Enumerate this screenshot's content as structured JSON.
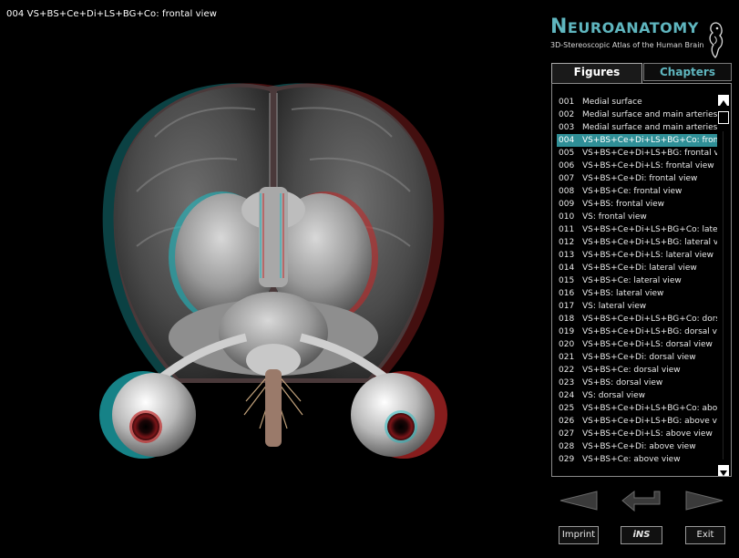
{
  "viewer": {
    "caption": "004  VS+BS+Ce+Di+LS+BG+Co: frontal view"
  },
  "logo": {
    "title_first": "N",
    "title_rest": "EUROANATOMY",
    "subtitle": "3D-Stereoscopic Atlas of the Human Brain"
  },
  "tabs": {
    "figures": "Figures",
    "chapters": "Chapters",
    "active": "Figures"
  },
  "figures": [
    {
      "num": "001",
      "label": "Medial surface"
    },
    {
      "num": "002",
      "label": "Medial surface and main arteries"
    },
    {
      "num": "003",
      "label": "Medial surface and main arteries"
    },
    {
      "num": "004",
      "label": "VS+BS+Ce+Di+LS+BG+Co: frontal view"
    },
    {
      "num": "005",
      "label": "VS+BS+Ce+Di+LS+BG: frontal view"
    },
    {
      "num": "006",
      "label": "VS+BS+Ce+Di+LS: frontal view"
    },
    {
      "num": "007",
      "label": "VS+BS+Ce+Di: frontal view"
    },
    {
      "num": "008",
      "label": "VS+BS+Ce: frontal view"
    },
    {
      "num": "009",
      "label": "VS+BS: frontal view"
    },
    {
      "num": "010",
      "label": "VS: frontal view"
    },
    {
      "num": "011",
      "label": "VS+BS+Ce+Di+LS+BG+Co: lateral view"
    },
    {
      "num": "012",
      "label": "VS+BS+Ce+Di+LS+BG: lateral view"
    },
    {
      "num": "013",
      "label": "VS+BS+Ce+Di+LS: lateral view"
    },
    {
      "num": "014",
      "label": "VS+BS+Ce+Di: lateral view"
    },
    {
      "num": "015",
      "label": "VS+BS+Ce: lateral view"
    },
    {
      "num": "016",
      "label": "VS+BS: lateral view"
    },
    {
      "num": "017",
      "label": "VS: lateral view"
    },
    {
      "num": "018",
      "label": "VS+BS+Ce+Di+LS+BG+Co: dorsal view"
    },
    {
      "num": "019",
      "label": "VS+BS+Ce+Di+LS+BG: dorsal view"
    },
    {
      "num": "020",
      "label": "VS+BS+Ce+Di+LS: dorsal view"
    },
    {
      "num": "021",
      "label": "VS+BS+Ce+Di: dorsal view"
    },
    {
      "num": "022",
      "label": "VS+BS+Ce: dorsal view"
    },
    {
      "num": "023",
      "label": "VS+BS: dorsal view"
    },
    {
      "num": "024",
      "label": "VS: dorsal view"
    },
    {
      "num": "025",
      "label": "VS+BS+Ce+Di+LS+BG+Co: above view"
    },
    {
      "num": "026",
      "label": "VS+BS+Ce+Di+LS+BG: above view"
    },
    {
      "num": "027",
      "label": "VS+BS+Ce+Di+LS: above view"
    },
    {
      "num": "028",
      "label": "VS+BS+Ce+Di: above view"
    },
    {
      "num": "029",
      "label": "VS+BS+Ce: above view"
    }
  ],
  "selected_figure": "004",
  "buttons": {
    "imprint": "Imprint",
    "ins": "iNS",
    "exit": "Exit"
  },
  "icons": {
    "prev": "arrow-left-icon",
    "back": "return-arrow-icon",
    "next": "arrow-right-icon",
    "logo": "seahorse-icon"
  },
  "colors": {
    "accent": "#5fb6bf",
    "selection": "#2f8f97",
    "background": "#000000"
  }
}
